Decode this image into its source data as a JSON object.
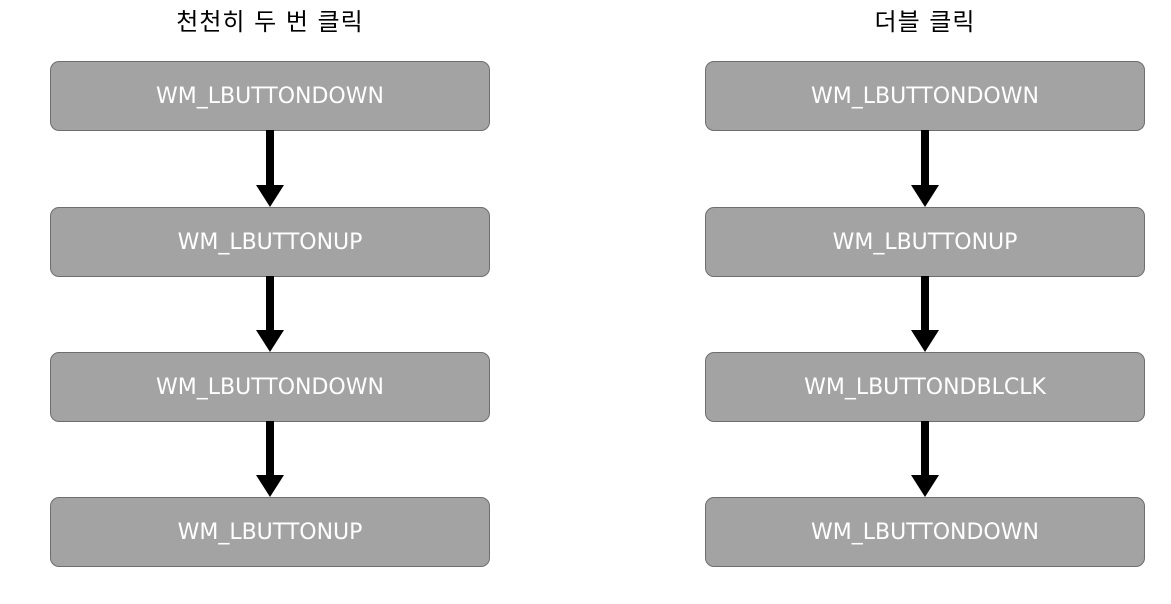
{
  "left": {
    "title": "천천히 두 번 클릭",
    "steps": [
      "WM_LBUTTONDOWN",
      "WM_LBUTTONUP",
      "WM_LBUTTONDOWN",
      "WM_LBUTTONUP"
    ]
  },
  "right": {
    "title": "더블 클릭",
    "steps": [
      "WM_LBUTTONDOWN",
      "WM_LBUTTONUP",
      "WM_LBUTTONDBLCLK",
      "WM_LBUTTONDOWN"
    ]
  },
  "colors": {
    "box_fill": "#a3a3a3",
    "box_border": "#6e6e6e",
    "box_text": "#ffffff",
    "arrow": "#000000"
  }
}
